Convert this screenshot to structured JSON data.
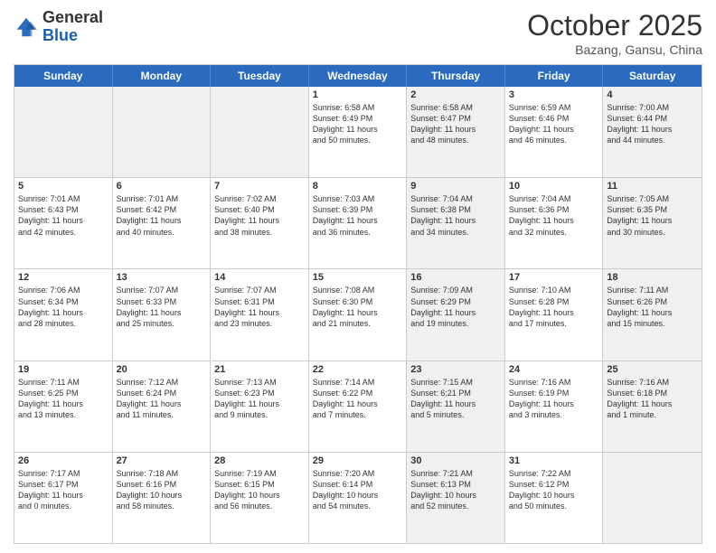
{
  "header": {
    "logo_general": "General",
    "logo_blue": "Blue",
    "month": "October 2025",
    "location": "Bazang, Gansu, China"
  },
  "weekdays": [
    "Sunday",
    "Monday",
    "Tuesday",
    "Wednesday",
    "Thursday",
    "Friday",
    "Saturday"
  ],
  "rows": [
    [
      {
        "day": "",
        "text": "",
        "shaded": false,
        "empty": true
      },
      {
        "day": "",
        "text": "",
        "shaded": false,
        "empty": true
      },
      {
        "day": "",
        "text": "",
        "shaded": false,
        "empty": true
      },
      {
        "day": "1",
        "text": "Sunrise: 6:58 AM\nSunset: 6:49 PM\nDaylight: 11 hours\nand 50 minutes.",
        "shaded": false,
        "empty": false
      },
      {
        "day": "2",
        "text": "Sunrise: 6:58 AM\nSunset: 6:47 PM\nDaylight: 11 hours\nand 48 minutes.",
        "shaded": true,
        "empty": false
      },
      {
        "day": "3",
        "text": "Sunrise: 6:59 AM\nSunset: 6:46 PM\nDaylight: 11 hours\nand 46 minutes.",
        "shaded": false,
        "empty": false
      },
      {
        "day": "4",
        "text": "Sunrise: 7:00 AM\nSunset: 6:44 PM\nDaylight: 11 hours\nand 44 minutes.",
        "shaded": true,
        "empty": false
      }
    ],
    [
      {
        "day": "5",
        "text": "Sunrise: 7:01 AM\nSunset: 6:43 PM\nDaylight: 11 hours\nand 42 minutes.",
        "shaded": false,
        "empty": false
      },
      {
        "day": "6",
        "text": "Sunrise: 7:01 AM\nSunset: 6:42 PM\nDaylight: 11 hours\nand 40 minutes.",
        "shaded": false,
        "empty": false
      },
      {
        "day": "7",
        "text": "Sunrise: 7:02 AM\nSunset: 6:40 PM\nDaylight: 11 hours\nand 38 minutes.",
        "shaded": false,
        "empty": false
      },
      {
        "day": "8",
        "text": "Sunrise: 7:03 AM\nSunset: 6:39 PM\nDaylight: 11 hours\nand 36 minutes.",
        "shaded": false,
        "empty": false
      },
      {
        "day": "9",
        "text": "Sunrise: 7:04 AM\nSunset: 6:38 PM\nDaylight: 11 hours\nand 34 minutes.",
        "shaded": true,
        "empty": false
      },
      {
        "day": "10",
        "text": "Sunrise: 7:04 AM\nSunset: 6:36 PM\nDaylight: 11 hours\nand 32 minutes.",
        "shaded": false,
        "empty": false
      },
      {
        "day": "11",
        "text": "Sunrise: 7:05 AM\nSunset: 6:35 PM\nDaylight: 11 hours\nand 30 minutes.",
        "shaded": true,
        "empty": false
      }
    ],
    [
      {
        "day": "12",
        "text": "Sunrise: 7:06 AM\nSunset: 6:34 PM\nDaylight: 11 hours\nand 28 minutes.",
        "shaded": false,
        "empty": false
      },
      {
        "day": "13",
        "text": "Sunrise: 7:07 AM\nSunset: 6:33 PM\nDaylight: 11 hours\nand 25 minutes.",
        "shaded": false,
        "empty": false
      },
      {
        "day": "14",
        "text": "Sunrise: 7:07 AM\nSunset: 6:31 PM\nDaylight: 11 hours\nand 23 minutes.",
        "shaded": false,
        "empty": false
      },
      {
        "day": "15",
        "text": "Sunrise: 7:08 AM\nSunset: 6:30 PM\nDaylight: 11 hours\nand 21 minutes.",
        "shaded": false,
        "empty": false
      },
      {
        "day": "16",
        "text": "Sunrise: 7:09 AM\nSunset: 6:29 PM\nDaylight: 11 hours\nand 19 minutes.",
        "shaded": true,
        "empty": false
      },
      {
        "day": "17",
        "text": "Sunrise: 7:10 AM\nSunset: 6:28 PM\nDaylight: 11 hours\nand 17 minutes.",
        "shaded": false,
        "empty": false
      },
      {
        "day": "18",
        "text": "Sunrise: 7:11 AM\nSunset: 6:26 PM\nDaylight: 11 hours\nand 15 minutes.",
        "shaded": true,
        "empty": false
      }
    ],
    [
      {
        "day": "19",
        "text": "Sunrise: 7:11 AM\nSunset: 6:25 PM\nDaylight: 11 hours\nand 13 minutes.",
        "shaded": false,
        "empty": false
      },
      {
        "day": "20",
        "text": "Sunrise: 7:12 AM\nSunset: 6:24 PM\nDaylight: 11 hours\nand 11 minutes.",
        "shaded": false,
        "empty": false
      },
      {
        "day": "21",
        "text": "Sunrise: 7:13 AM\nSunset: 6:23 PM\nDaylight: 11 hours\nand 9 minutes.",
        "shaded": false,
        "empty": false
      },
      {
        "day": "22",
        "text": "Sunrise: 7:14 AM\nSunset: 6:22 PM\nDaylight: 11 hours\nand 7 minutes.",
        "shaded": false,
        "empty": false
      },
      {
        "day": "23",
        "text": "Sunrise: 7:15 AM\nSunset: 6:21 PM\nDaylight: 11 hours\nand 5 minutes.",
        "shaded": true,
        "empty": false
      },
      {
        "day": "24",
        "text": "Sunrise: 7:16 AM\nSunset: 6:19 PM\nDaylight: 11 hours\nand 3 minutes.",
        "shaded": false,
        "empty": false
      },
      {
        "day": "25",
        "text": "Sunrise: 7:16 AM\nSunset: 6:18 PM\nDaylight: 11 hours\nand 1 minute.",
        "shaded": true,
        "empty": false
      }
    ],
    [
      {
        "day": "26",
        "text": "Sunrise: 7:17 AM\nSunset: 6:17 PM\nDaylight: 11 hours\nand 0 minutes.",
        "shaded": false,
        "empty": false
      },
      {
        "day": "27",
        "text": "Sunrise: 7:18 AM\nSunset: 6:16 PM\nDaylight: 10 hours\nand 58 minutes.",
        "shaded": false,
        "empty": false
      },
      {
        "day": "28",
        "text": "Sunrise: 7:19 AM\nSunset: 6:15 PM\nDaylight: 10 hours\nand 56 minutes.",
        "shaded": false,
        "empty": false
      },
      {
        "day": "29",
        "text": "Sunrise: 7:20 AM\nSunset: 6:14 PM\nDaylight: 10 hours\nand 54 minutes.",
        "shaded": false,
        "empty": false
      },
      {
        "day": "30",
        "text": "Sunrise: 7:21 AM\nSunset: 6:13 PM\nDaylight: 10 hours\nand 52 minutes.",
        "shaded": true,
        "empty": false
      },
      {
        "day": "31",
        "text": "Sunrise: 7:22 AM\nSunset: 6:12 PM\nDaylight: 10 hours\nand 50 minutes.",
        "shaded": false,
        "empty": false
      },
      {
        "day": "",
        "text": "",
        "shaded": true,
        "empty": true
      }
    ]
  ]
}
